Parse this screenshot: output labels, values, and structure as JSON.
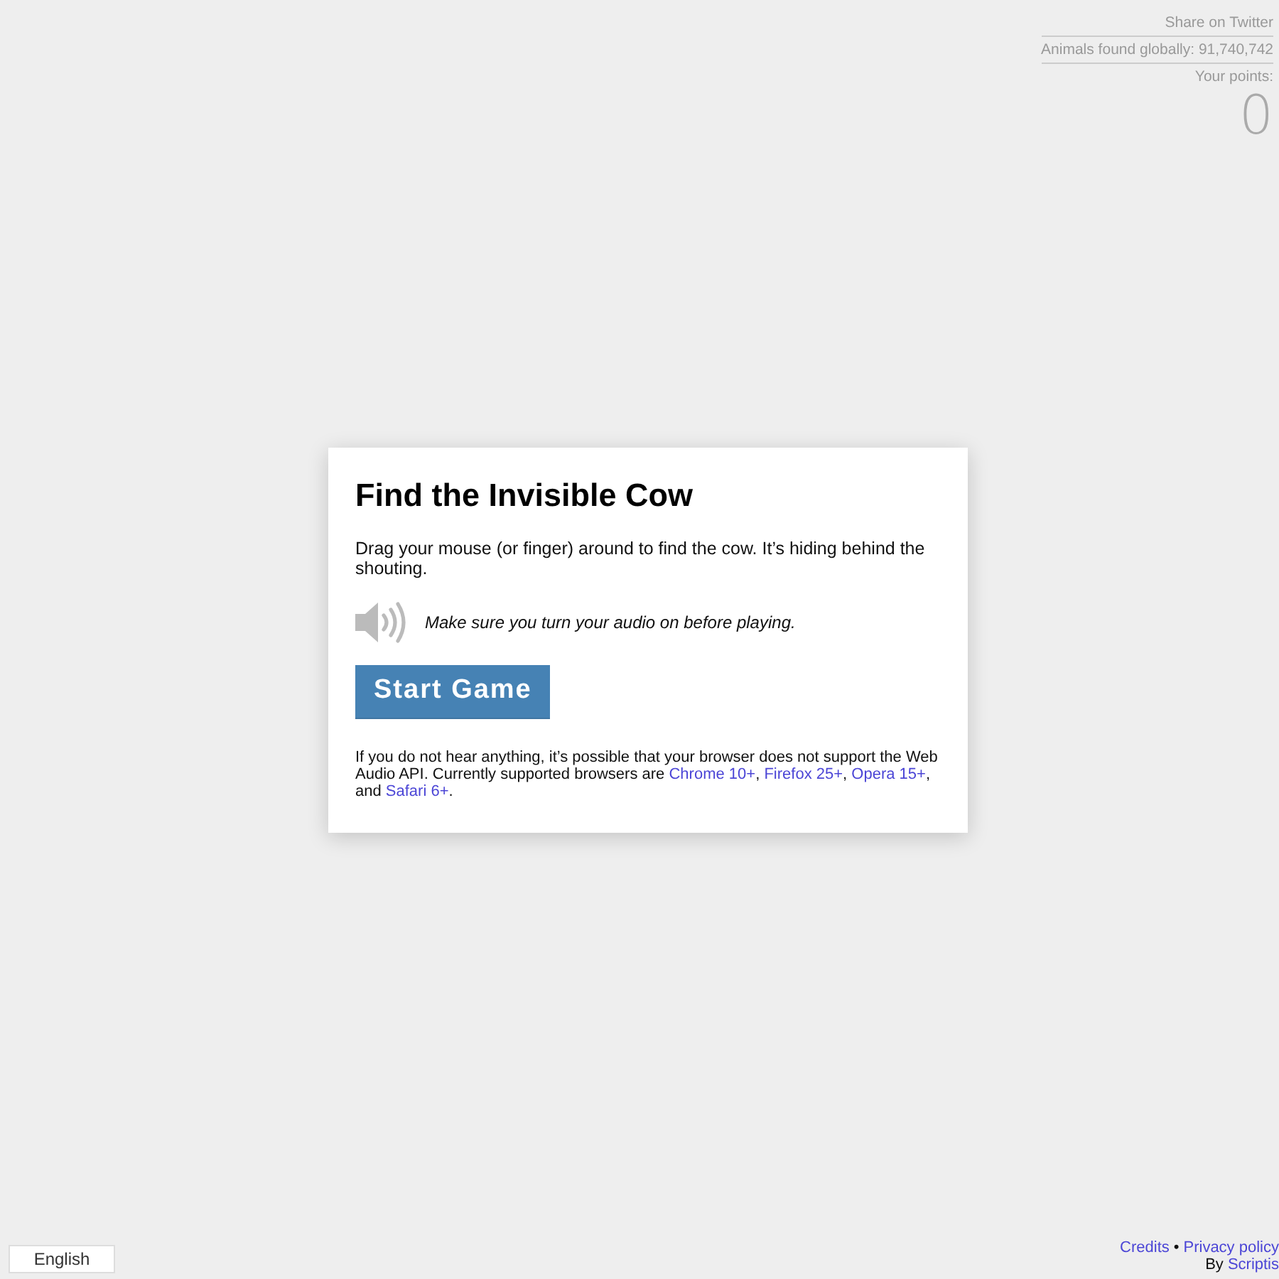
{
  "top_panel": {
    "share_link": "Share on Twitter",
    "animals_found": "Animals found globally: 91,740,742",
    "points_label": "Your points:",
    "points": "0"
  },
  "card": {
    "title": "Find the Invisible Cow",
    "intro": "Drag your mouse (or finger) around to find the cow. It’s hiding behind the shouting.",
    "audio_note": "Make sure you turn your audio on before playing.",
    "start_button": "Start Game",
    "footnote": [
      {
        "kind": "text",
        "text": "If you do not hear anything, it’s possible that your browser does not support the Web Audio API. Currently supported browsers are "
      },
      {
        "kind": "link",
        "text": "Chrome 10+"
      },
      {
        "kind": "text",
        "text": ", "
      },
      {
        "kind": "link",
        "text": "Firefox 25+"
      },
      {
        "kind": "text",
        "text": ", "
      },
      {
        "kind": "link",
        "text": "Opera 15+"
      },
      {
        "kind": "text",
        "text": ", and "
      },
      {
        "kind": "link",
        "text": "Safari 6+"
      },
      {
        "kind": "text",
        "text": "."
      }
    ]
  },
  "language_select": {
    "value": "English"
  },
  "footer": {
    "links": [
      "Credits",
      "Privacy policy"
    ],
    "separator": "•",
    "byline": "By",
    "author_link": "Scriptis"
  }
}
